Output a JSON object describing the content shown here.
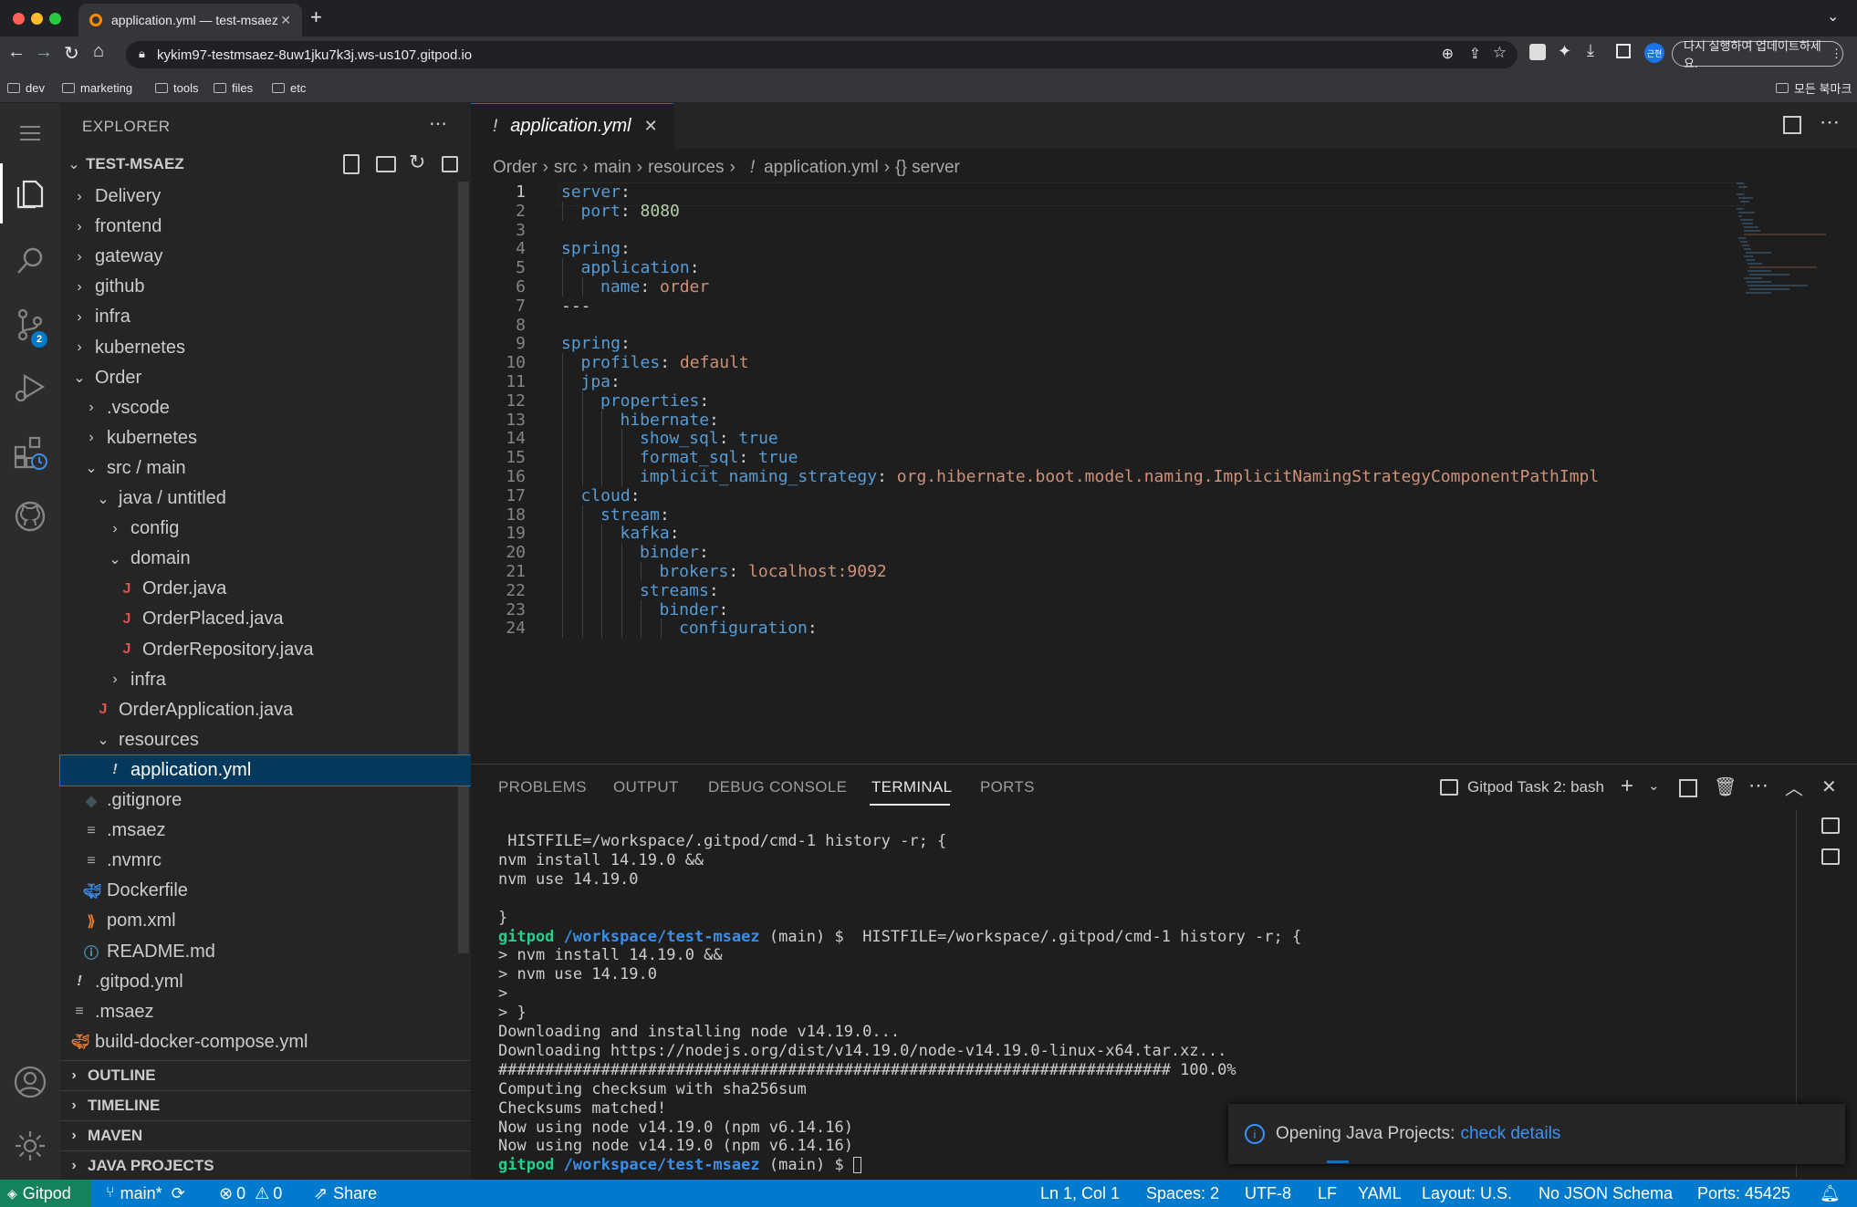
{
  "browser": {
    "tab_title": "application.yml — test-msaez",
    "new_tab": "+",
    "url": "kykim97-testmsaez-8uw1jku7k3j.ws-us107.gitpod.io",
    "update_button": "다시 실행하여 업데이트하세요.",
    "profile_badge": "근현",
    "bookmarks": [
      "dev",
      "marketing",
      "tools",
      "files",
      "etc"
    ],
    "all_bookmarks": "모든 북마크"
  },
  "activity_bar": {
    "scm_badge": "2"
  },
  "explorer": {
    "title": "EXPLORER",
    "root": "TEST-MSAEZ",
    "items": [
      {
        "label": "Delivery",
        "type": "folder",
        "open": false
      },
      {
        "label": "frontend",
        "type": "folder",
        "open": false
      },
      {
        "label": "gateway",
        "type": "folder",
        "open": false
      },
      {
        "label": "github",
        "type": "folder",
        "open": false
      },
      {
        "label": "infra",
        "type": "folder",
        "open": false
      },
      {
        "label": "kubernetes",
        "type": "folder",
        "open": false
      },
      {
        "label": "Order",
        "type": "folder",
        "open": true
      },
      {
        "label": ".vscode",
        "type": "folder",
        "open": false
      },
      {
        "label": "kubernetes",
        "type": "folder",
        "open": false
      },
      {
        "label": "src / main",
        "type": "folder",
        "open": true
      },
      {
        "label": "java / untitled",
        "type": "folder",
        "open": true
      },
      {
        "label": "config",
        "type": "folder",
        "open": false
      },
      {
        "label": "domain",
        "type": "folder",
        "open": true
      },
      {
        "label": "Order.java",
        "type": "java"
      },
      {
        "label": "OrderPlaced.java",
        "type": "java"
      },
      {
        "label": "OrderRepository.java",
        "type": "java"
      },
      {
        "label": "infra",
        "type": "folder",
        "open": false
      },
      {
        "label": "OrderApplication.java",
        "type": "java"
      },
      {
        "label": "resources",
        "type": "folder",
        "open": true
      },
      {
        "label": "application.yml",
        "type": "yaml",
        "selected": true
      },
      {
        "label": ".gitignore",
        "type": "git"
      },
      {
        "label": ".msaez",
        "type": "text"
      },
      {
        "label": ".nvmrc",
        "type": "text"
      },
      {
        "label": "Dockerfile",
        "type": "docker"
      },
      {
        "label": "pom.xml",
        "type": "xml"
      },
      {
        "label": "README.md",
        "type": "info"
      },
      {
        "label": ".gitpod.yml",
        "type": "yaml"
      },
      {
        "label": ".msaez",
        "type": "text"
      },
      {
        "label": "build-docker-compose.yml",
        "type": "compose"
      }
    ],
    "sections": [
      "OUTLINE",
      "TIMELINE",
      "MAVEN",
      "JAVA PROJECTS"
    ]
  },
  "editor": {
    "tab_label": "application.yml",
    "tab_icon": "!",
    "breadcrumb": [
      "Order",
      "src",
      "main",
      "resources",
      "application.yml",
      "{} server"
    ],
    "lines": [
      {
        "n": "1",
        "ind": 0,
        "key": "server",
        "sep": ":",
        "val": "",
        "vt": ""
      },
      {
        "n": "2",
        "ind": 1,
        "key": "port",
        "sep": ": ",
        "val": "8080",
        "vt": "n"
      },
      {
        "n": "3",
        "ind": 0,
        "key": "",
        "sep": "",
        "val": "",
        "vt": ""
      },
      {
        "n": "4",
        "ind": 0,
        "key": "spring",
        "sep": ":",
        "val": "",
        "vt": ""
      },
      {
        "n": "5",
        "ind": 1,
        "key": "application",
        "sep": ":",
        "val": "",
        "vt": ""
      },
      {
        "n": "6",
        "ind": 2,
        "key": "name",
        "sep": ": ",
        "val": "order",
        "vt": "s"
      },
      {
        "n": "7",
        "ind": 0,
        "key": "",
        "sep": "",
        "val": "---",
        "vt": "w"
      },
      {
        "n": "8",
        "ind": 0,
        "key": "",
        "sep": "",
        "val": "",
        "vt": ""
      },
      {
        "n": "9",
        "ind": 0,
        "key": "spring",
        "sep": ":",
        "val": "",
        "vt": ""
      },
      {
        "n": "10",
        "ind": 1,
        "key": "profiles",
        "sep": ": ",
        "val": "default",
        "vt": "s"
      },
      {
        "n": "11",
        "ind": 1,
        "key": "jpa",
        "sep": ":",
        "val": "",
        "vt": ""
      },
      {
        "n": "12",
        "ind": 2,
        "key": "properties",
        "sep": ":",
        "val": "",
        "vt": ""
      },
      {
        "n": "13",
        "ind": 3,
        "key": "hibernate",
        "sep": ":",
        "val": "",
        "vt": ""
      },
      {
        "n": "14",
        "ind": 4,
        "key": "show_sql",
        "sep": ": ",
        "val": "true",
        "vt": "k"
      },
      {
        "n": "15",
        "ind": 4,
        "key": "format_sql",
        "sep": ": ",
        "val": "true",
        "vt": "k"
      },
      {
        "n": "16",
        "ind": 4,
        "key": "implicit_naming_strategy",
        "sep": ": ",
        "val": "org.hibernate.boot.model.naming.ImplicitNamingStrategyComponentPathImpl",
        "vt": "s"
      },
      {
        "n": "17",
        "ind": 1,
        "key": "cloud",
        "sep": ":",
        "val": "",
        "vt": ""
      },
      {
        "n": "18",
        "ind": 2,
        "key": "stream",
        "sep": ":",
        "val": "",
        "vt": ""
      },
      {
        "n": "19",
        "ind": 3,
        "key": "kafka",
        "sep": ":",
        "val": "",
        "vt": ""
      },
      {
        "n": "20",
        "ind": 4,
        "key": "binder",
        "sep": ":",
        "val": "",
        "vt": ""
      },
      {
        "n": "21",
        "ind": 5,
        "key": "brokers",
        "sep": ": ",
        "val": "localhost:9092",
        "vt": "s"
      },
      {
        "n": "22",
        "ind": 4,
        "key": "streams",
        "sep": ":",
        "val": "",
        "vt": ""
      },
      {
        "n": "23",
        "ind": 5,
        "key": "binder",
        "sep": ":",
        "val": "",
        "vt": ""
      },
      {
        "n": "24",
        "ind": 6,
        "key": "configuration",
        "sep": ":",
        "val": "",
        "vt": ""
      }
    ]
  },
  "panel": {
    "tabs": [
      "PROBLEMS",
      "OUTPUT",
      "DEBUG CONSOLE",
      "TERMINAL",
      "PORTS"
    ],
    "active_tab": "TERMINAL",
    "terminal_name": "Gitpod Task 2: bash",
    "terminal_lines": [
      {
        "t": " HISTFILE=/workspace/.gitpod/cmd-1 history -r; {"
      },
      {
        "t": "nvm install 14.19.0 &&"
      },
      {
        "t": "nvm use 14.19.0"
      },
      {
        "t": ""
      },
      {
        "t": "}"
      },
      {
        "prompt": true,
        "user": "gitpod",
        "path": "/workspace/test-msaez",
        "rest": " (main) $  HISTFILE=/workspace/.gitpod/cmd-1 history -r; {"
      },
      {
        "t": "> nvm install 14.19.0 &&"
      },
      {
        "t": "> nvm use 14.19.0"
      },
      {
        "t": ">"
      },
      {
        "t": "> }"
      },
      {
        "t": "Downloading and installing node v14.19.0..."
      },
      {
        "t": "Downloading https://nodejs.org/dist/v14.19.0/node-v14.19.0-linux-x64.tar.xz..."
      },
      {
        "t": "######################################################################## 100.0%"
      },
      {
        "t": "Computing checksum with sha256sum"
      },
      {
        "t": "Checksums matched!"
      },
      {
        "t": "Now using node v14.19.0 (npm v6.14.16)"
      },
      {
        "t": "Now using node v14.19.0 (npm v6.14.16)"
      },
      {
        "prompt": true,
        "user": "gitpod",
        "path": "/workspace/test-msaez",
        "rest": " (main) $ ",
        "cursor": true
      }
    ]
  },
  "notification": {
    "text": "Opening Java Projects: ",
    "link": "check details"
  },
  "status_bar": {
    "gitpod": "Gitpod",
    "branch": "main*",
    "errors": "0",
    "warnings": "0",
    "share": "Share",
    "position": "Ln 1, Col 1",
    "spaces": "Spaces: 2",
    "encoding": "UTF-8",
    "eol": "LF",
    "language": "YAML",
    "layout": "Layout: U.S.",
    "schema": "No JSON Schema",
    "ports": "Ports: 45425"
  },
  "colors": {
    "status_bar": "#007acc",
    "gitpod_badge": "#16825d",
    "yaml_key": "#569cd6",
    "yaml_string": "#ce9178",
    "yaml_number": "#b5cea8",
    "terminal_user": "#23d18b",
    "terminal_path": "#3b8eea"
  }
}
